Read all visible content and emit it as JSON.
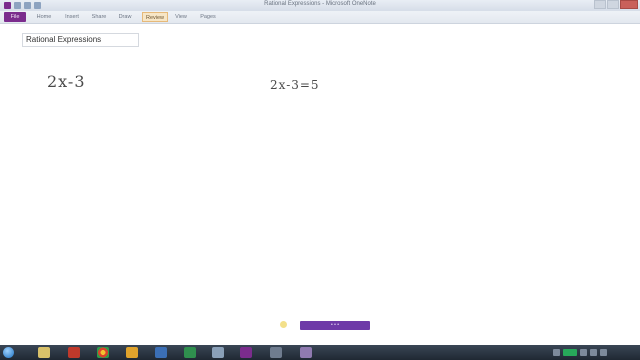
{
  "window": {
    "title": "Rational Expressions - Microsoft OneNote"
  },
  "ribbon": {
    "tabs": [
      {
        "label": "File"
      },
      {
        "label": "Home"
      },
      {
        "label": "Insert"
      },
      {
        "label": "Share"
      },
      {
        "label": "Draw"
      },
      {
        "label": "Review"
      },
      {
        "label": "View"
      },
      {
        "label": "Pages"
      }
    ]
  },
  "page": {
    "title": "Rational Expressions",
    "ink": [
      {
        "text": "2x-3"
      },
      {
        "text": "2x-3=5"
      }
    ]
  },
  "pager": {
    "label": "• • •"
  },
  "colors": {
    "file_tab": "#7b2c8d",
    "pager": "#6e3aa8",
    "taskbar": "#1f2833"
  }
}
